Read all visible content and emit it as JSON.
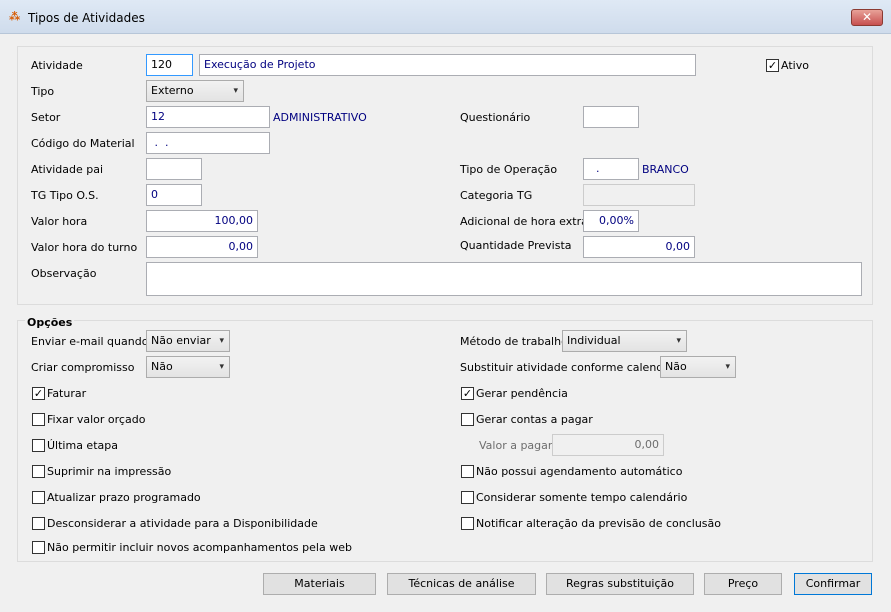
{
  "window": {
    "title": "Tipos de Atividades",
    "close_label": "✕"
  },
  "fields": {
    "atividade": {
      "label": "Atividade",
      "code": "120",
      "description": "Execução de Projeto"
    },
    "ativo": {
      "label": "Ativo",
      "checked": true
    },
    "tipo": {
      "label": "Tipo",
      "value": "Externo"
    },
    "setor": {
      "label": "Setor",
      "value": "12",
      "link": "ADMINISTRATIVO"
    },
    "questionario": {
      "label": "Questionário",
      "value": ""
    },
    "codigo_material": {
      "label": "Código do Material",
      "value": " .  ."
    },
    "atividade_pai": {
      "label": "Atividade pai",
      "value": ""
    },
    "tipo_operacao": {
      "label": "Tipo de Operação",
      "value": ".",
      "link": "BRANCO"
    },
    "tg_tipo_os": {
      "label": "TG Tipo O.S.",
      "value": "0"
    },
    "categoria_tg": {
      "label": "Categoria TG",
      "value": ""
    },
    "valor_hora": {
      "label": "Valor hora",
      "value": "100,00"
    },
    "adicional_hora_extra": {
      "label": "Adicional de hora extra",
      "value": "0,00%"
    },
    "valor_hora_turno": {
      "label": "Valor hora do turno",
      "value": "0,00"
    },
    "quantidade_prevista": {
      "label": "Quantidade Prevista",
      "value": "0,00"
    },
    "observacao": {
      "label": "Observação",
      "value": ""
    }
  },
  "opcoes": {
    "title": "Opções",
    "enviar_email": {
      "label": "Enviar e-mail quando",
      "value": "Não enviar"
    },
    "criar_compromisso": {
      "label": "Criar compromisso",
      "value": "Não"
    },
    "metodo_trabalho": {
      "label": "Método de trabalho",
      "value": "Individual"
    },
    "substituir_atividade": {
      "label": "Substituir atividade conforme calendário",
      "value": "Não"
    },
    "valor_a_pagar": {
      "label": "Valor a pagar",
      "value": "0,00"
    },
    "left_checks": [
      {
        "label": "Faturar",
        "checked": true
      },
      {
        "label": "Fixar valor orçado",
        "checked": false
      },
      {
        "label": "Última etapa",
        "checked": false
      },
      {
        "label": "Suprimir na impressão",
        "checked": false
      },
      {
        "label": "Atualizar prazo programado",
        "checked": false
      },
      {
        "label": "Desconsiderar a atividade para a Disponibilidade",
        "checked": false
      },
      {
        "label": "Não permitir incluir novos acompanhamentos pela web",
        "checked": false
      }
    ],
    "right_checks": [
      {
        "label": "Gerar pendência",
        "checked": true
      },
      {
        "label": "Gerar contas a pagar",
        "checked": false
      },
      {
        "label": "Não possui agendamento automático",
        "checked": false
      },
      {
        "label": "Considerar somente tempo calendário",
        "checked": false
      },
      {
        "label": "Notificar alteração da previsão de conclusão",
        "checked": false
      }
    ]
  },
  "buttons": {
    "materiais": "Materiais",
    "tecnicas": "Técnicas de análise",
    "regras": "Regras substituição",
    "preco": "Preço",
    "confirmar": "Confirmar"
  },
  "icons": {
    "check_glyph": "✓",
    "chevron_glyph": "▾"
  }
}
